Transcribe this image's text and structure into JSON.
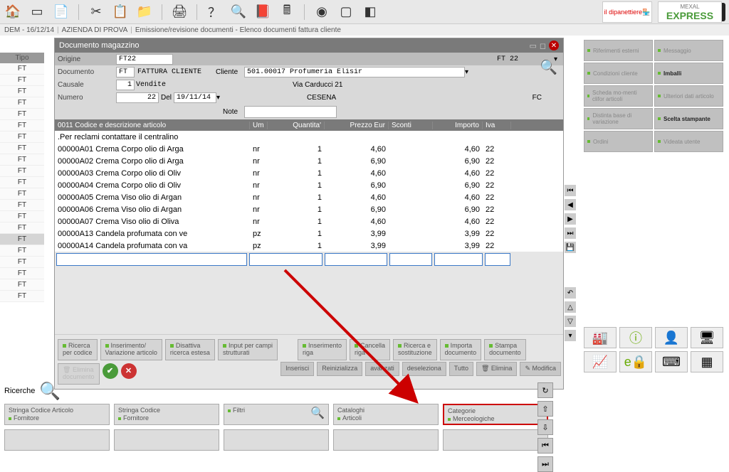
{
  "breadcrumb": {
    "p1": "DEM - 16/12/14",
    "p2": "AZIENDA DI PROVA",
    "p3": "Emissione/revisione documenti - Elenco documenti fattura cliente"
  },
  "logos": {
    "shop": "il dipanettiere",
    "express": "EXPRESS",
    "express_sub": "MEXAL"
  },
  "leftcol": {
    "header": "Tipo",
    "items": [
      "FT",
      "FT",
      "FT",
      "FT",
      "FT",
      "FT",
      "FT",
      "FT",
      "FT",
      "FT",
      "FT",
      "FT",
      "FT",
      "FT",
      "FT",
      "FT",
      "FT",
      "FT",
      "FT",
      "FT",
      "FT"
    ]
  },
  "dialog": {
    "title": "Documento magazzino",
    "origine_lbl": "Origine",
    "origine": "FT22",
    "origine_right": "FT 22",
    "documento_lbl": "Documento",
    "documento": "FT",
    "documento_desc": "FATTURA CLIENTE",
    "cliente_lbl": "Cliente",
    "cliente": "501.00017 Profumeria Elisir",
    "causale_lbl": "Causale",
    "causale": "1",
    "causale_desc": "Vendite",
    "addr": "Via Carducci 21",
    "numero_lbl": "Numero",
    "numero": "22",
    "del_lbl": "Del",
    "del": "19/11/14",
    "city": "CESENA",
    "prov": "FC",
    "note_lbl": "Note",
    "note": "",
    "grid_headers": {
      "code": "0011   Codice e descrizione articolo",
      "um": "Um",
      "qty": "Quantita'",
      "prz": "Prezzo    Eur",
      "sc": "Sconti",
      "imp": "Importo",
      "iva": "Iva"
    },
    "first_line": ".Per reclami contattare il centralino",
    "rows": [
      {
        "code": "00000A01",
        "desc": "Crema Corpo olio di Arga",
        "um": "nr",
        "qty": "1",
        "prz": "4,60",
        "imp": "4,60",
        "iva": "22"
      },
      {
        "code": "00000A02",
        "desc": "Crema Corpo olio di Arga",
        "um": "nr",
        "qty": "1",
        "prz": "6,90",
        "imp": "6,90",
        "iva": "22"
      },
      {
        "code": "00000A03",
        "desc": "Crema Corpo olio di Oliv",
        "um": "nr",
        "qty": "1",
        "prz": "4,60",
        "imp": "4,60",
        "iva": "22"
      },
      {
        "code": "00000A04",
        "desc": "Crema Corpo olio di Oliv",
        "um": "nr",
        "qty": "1",
        "prz": "6,90",
        "imp": "6,90",
        "iva": "22"
      },
      {
        "code": "00000A05",
        "desc": "Crema Viso olio di Argan",
        "um": "nr",
        "qty": "1",
        "prz": "4,60",
        "imp": "4,60",
        "iva": "22"
      },
      {
        "code": "00000A06",
        "desc": "Crema Viso olio di Argan",
        "um": "nr",
        "qty": "1",
        "prz": "6,90",
        "imp": "6,90",
        "iva": "22"
      },
      {
        "code": "00000A07",
        "desc": "Crema Viso olio di Oliva",
        "um": "nr",
        "qty": "1",
        "prz": "4,60",
        "imp": "4,60",
        "iva": "22"
      },
      {
        "code": "00000A13",
        "desc": "Candela profumata con ve",
        "um": "pz",
        "qty": "1",
        "prz": "3,99",
        "imp": "3,99",
        "iva": "22"
      },
      {
        "code": "00000A14",
        "desc": "Candela profumata con va",
        "um": "pz",
        "qty": "1",
        "prz": "3,99",
        "imp": "3,99",
        "iva": "22"
      }
    ],
    "btns": {
      "b1a": "Ricerca",
      "b1b": "per codice",
      "b2a": "Inserimento/",
      "b2b": "Variazione articolo",
      "b3a": "Disattiva",
      "b3b": "ricerca estesa",
      "b4a": "Input per campi",
      "b4b": "strutturati",
      "b5a": "Inserimento",
      "b5b": "riga",
      "b6a": "Cancella",
      "b6b": "riga",
      "b7a": "Ricerca e",
      "b7b": "sostituzione",
      "b8a": "Importa",
      "b8b": "documento",
      "b9a": "Stampa",
      "b9b": "documento",
      "b10a": "Elimina",
      "b10b": "documento"
    },
    "btns2": {
      "a": "Inserisci",
      "b": "Reinizializza",
      "c": "avanzati",
      "d": "deseleziona",
      "e": "Tutto",
      "f": "Elimina",
      "g": "Modifica"
    }
  },
  "search": {
    "label": "Ricerche",
    "c1a": "Stringa Codice Articolo",
    "c1b": "Fornitore",
    "c2a": "Stringa Codice",
    "c2b": "Fornitore",
    "c3": "Filtri",
    "c4a": "Cataloghi",
    "c4b": "Articoli",
    "c5a": "Categorie",
    "c5b": "Merceologiche"
  },
  "right": {
    "r1": "Riferimenti esterni",
    "r2": "Messaggio",
    "r3": "Condizioni cliente",
    "r4": "Imballi",
    "r5": "Scheda mo-menti clifor articoli",
    "r6": "Ulteriori dati articolo",
    "r7": "Distinta base di variazione",
    "r8": "Scelta stampante",
    "r9": "Ordini",
    "r10": "Videata utente"
  }
}
